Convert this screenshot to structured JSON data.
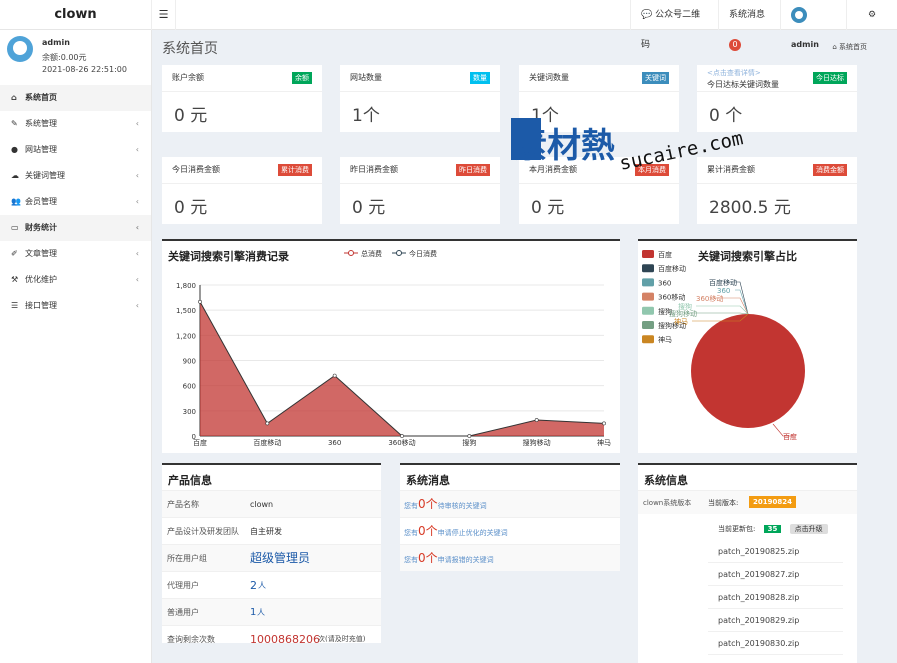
{
  "header": {
    "logo": "clown",
    "menu_icon": "hamburger-icon",
    "qrcode": "公众号二维码",
    "messages": "系统消息",
    "messages_badge": "0",
    "user": "admin",
    "settings_icon": "gears-icon"
  },
  "sidebar": {
    "username": "admin",
    "balance": "余额:0.00元",
    "datetime": "2021-08-26 22:51:00",
    "items": [
      {
        "label": "系统首页",
        "icon": "home-icon",
        "active": true
      },
      {
        "label": "系统管理",
        "icon": "wrench-icon",
        "arrow": "‹"
      },
      {
        "label": "网站管理",
        "icon": "circle-icon",
        "arrow": "‹"
      },
      {
        "label": "关键词管理",
        "icon": "cloud-icon",
        "arrow": "‹"
      },
      {
        "label": "会员管理",
        "icon": "users-icon",
        "arrow": "‹"
      },
      {
        "label": "财务统计",
        "icon": "card-icon",
        "arrow": "‹",
        "active": true
      },
      {
        "label": "文章管理",
        "icon": "edit-icon",
        "arrow": "‹"
      },
      {
        "label": "优化维护",
        "icon": "tools-icon",
        "arrow": "‹"
      },
      {
        "label": "接口管理",
        "icon": "list-icon",
        "arrow": "‹"
      }
    ]
  },
  "page": {
    "title": "系统首页",
    "breadcrumb": "系统首页"
  },
  "cards": [
    {
      "title": "账户余额",
      "tag": "余额",
      "tag_color": "#00a65a",
      "value": "0 元"
    },
    {
      "title": "网站数量",
      "tag": "数量",
      "tag_color": "#00c0ef",
      "value": "1个"
    },
    {
      "title": "关键词数量",
      "tag": "关键词",
      "tag_color": "#3c8dbc",
      "value": "1个"
    },
    {
      "title": "今日达标关键词数量",
      "link": "<点击查看详情>",
      "tag": "今日达标",
      "tag_color": "#00a65a",
      "value": "0 个"
    },
    {
      "title": "今日消费金额",
      "tag": "累计消费",
      "tag_color": "#dd4b39",
      "value": "0 元"
    },
    {
      "title": "昨日消费金额",
      "tag": "昨日消费",
      "tag_color": "#dd4b39",
      "value": "0 元"
    },
    {
      "title": "本月消费金额",
      "tag": "本月消费",
      "tag_color": "#dd4b39",
      "value": "0 元"
    },
    {
      "title": "累计消费金额",
      "tag": "消费金额",
      "tag_color": "#dd4b39",
      "value": "2800.5 元"
    }
  ],
  "chart_data": [
    {
      "type": "area",
      "title": "关键词搜索引擎消费记录",
      "legend": [
        "总消费",
        "今日消费"
      ],
      "categories": [
        "百度",
        "百度移动",
        "360",
        "360移动",
        "搜狗",
        "搜狗移动",
        "神马"
      ],
      "series": [
        {
          "name": "总消费",
          "values": [
            1600,
            150,
            720,
            0,
            0,
            190,
            150
          ]
        },
        {
          "name": "今日消费",
          "values": [
            0,
            0,
            0,
            0,
            0,
            0,
            0
          ]
        }
      ],
      "yticks": [
        "1,800",
        "1,500",
        "1,200",
        "900",
        "600",
        "300",
        "0"
      ],
      "ylim": [
        0,
        1800
      ],
      "color": "#c23531"
    },
    {
      "type": "pie",
      "title": "关键词搜索引擎占比",
      "legend": [
        {
          "name": "百度",
          "color": "#c23531"
        },
        {
          "name": "百度移动",
          "color": "#2f4554"
        },
        {
          "name": "360",
          "color": "#61a0a8"
        },
        {
          "name": "360移动",
          "color": "#d48265"
        },
        {
          "name": "搜狗",
          "color": "#91c7ae"
        },
        {
          "name": "搜狗移动",
          "color": "#749f83"
        },
        {
          "name": "神马",
          "color": "#ca8622"
        }
      ],
      "values": [
        100,
        0,
        0,
        0,
        0,
        0,
        0
      ],
      "labels": [
        "百度移动",
        "360",
        "360移动",
        "搜狗",
        "搜狗移动",
        "神马",
        "百度"
      ]
    }
  ],
  "product": {
    "title": "产品信息",
    "rows": [
      {
        "k": "产品名称",
        "v": "clown"
      },
      {
        "k": "产品设计及研发团队",
        "v": "自主研发"
      },
      {
        "k": "所在用户组",
        "v": "超级管理员"
      },
      {
        "k": "代理用户",
        "v": "2",
        "unit": "人"
      },
      {
        "k": "普通用户",
        "v": "1",
        "unit": "人"
      },
      {
        "k": "查询剩余次数",
        "v": "1000868206",
        "unit": "次(请及时充值)"
      }
    ]
  },
  "sysmsg": {
    "title": "系统消息",
    "items": [
      {
        "pre": "您有",
        "n": "0个",
        "post": "待审核的关键词"
      },
      {
        "pre": "您有",
        "n": "0个",
        "post": "申请停止优化的关键词"
      },
      {
        "pre": "您有",
        "n": "0个",
        "post": "申请报错的关键词"
      }
    ]
  },
  "sysinfo": {
    "title": "系统信息",
    "version_label": "clown系统版本",
    "current_label": "当前版本:",
    "current_version": "20190824",
    "update_label": "当前更新包:",
    "update_count": "35",
    "upgrade": "点击升级",
    "patches": [
      "patch_20190825.zip",
      "patch_20190827.zip",
      "patch_20190828.zip",
      "patch_20190829.zip",
      "patch_20190830.zip"
    ]
  },
  "watermark": {
    "text1": "素材熱",
    "text2": "sucaire.com"
  }
}
